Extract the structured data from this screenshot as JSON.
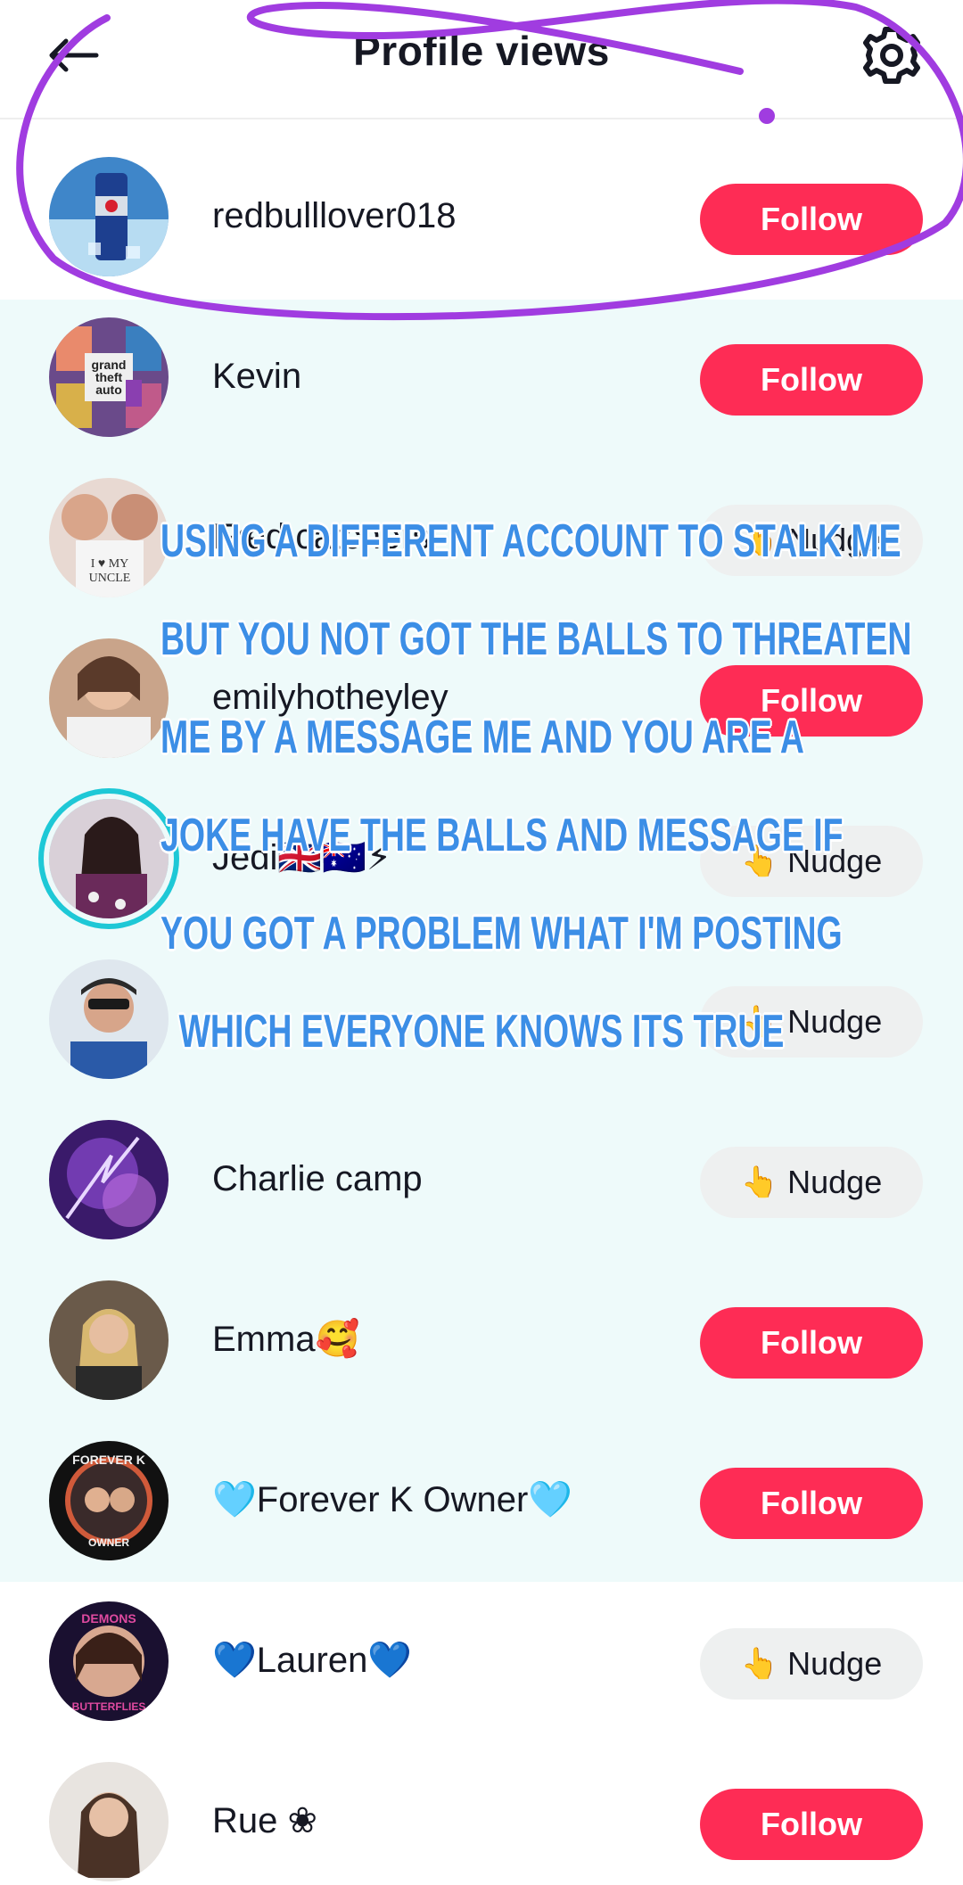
{
  "header": {
    "title": "Profile views",
    "back_icon": "arrow-left-icon",
    "settings_icon": "gear-icon"
  },
  "colors": {
    "follow": "#fe2c55",
    "nudge_bg": "#eef0f0",
    "tint": "#eefafa",
    "overlay_text": "#3c8ee6",
    "scribble": "#a03ce0",
    "story_ring": "#1ec8d6"
  },
  "rows": [
    {
      "name": "redbulllover018",
      "action": "Follow"
    },
    {
      "name": "Kevin",
      "action": "Follow"
    },
    {
      "name": "Fred catchers",
      "action": "Nudge",
      "icon": "👆"
    },
    {
      "name": "emilyhotheyley",
      "action": "Follow"
    },
    {
      "name": "Jedi🇬🇧🇦🇺⚡",
      "action": "Nudge",
      "icon": "👆"
    },
    {
      "name": "",
      "action": "Nudge",
      "icon": "👆"
    },
    {
      "name": "Charlie camp",
      "action": "Nudge",
      "icon": "👆"
    },
    {
      "name": "Emma🥰",
      "action": "Follow"
    },
    {
      "name": "🩵Forever K Owner🩵",
      "action": "Follow"
    },
    {
      "name": "💙Lauren💙",
      "action": "Nudge",
      "icon": "👆"
    },
    {
      "name": "Rue ❀",
      "action": "Follow"
    }
  ],
  "overlay": {
    "lines": [
      "USING A DIFFERENT ACCOUNT TO STALK ME",
      "BUT YOU NOT GOT THE BALLS TO THREATEN",
      "ME BY A MESSAGE ME AND YOU ARE A",
      "JOKE HAVE THE BALLS AND MESSAGE IF",
      "YOU GOT A PROBLEM WHAT I'M POSTING",
      "WHICH EVERYONE KNOWS ITS TRUE"
    ]
  }
}
